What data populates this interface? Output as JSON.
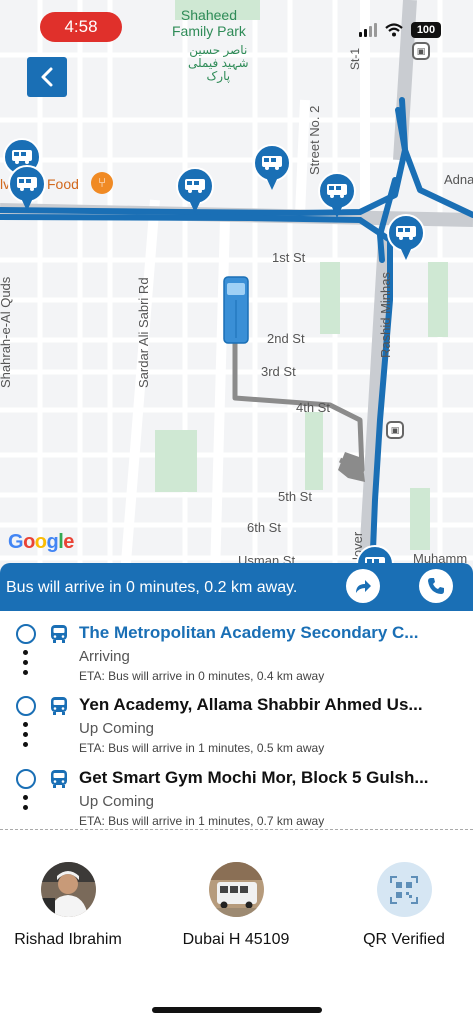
{
  "status_bar": {
    "time": "4:58",
    "battery": "100"
  },
  "map": {
    "park_name": "Shaheed\nFamily Park",
    "park_name_urdu": "ناصر حسین\nشہید فیملی\nپارک",
    "food_label": "Food",
    "food_label_prefix": "lv",
    "streets": {
      "st1": "St-1",
      "street_no2": "Street No. 2",
      "adna": "Adna",
      "first_st": "1st St",
      "second_st": "2nd St",
      "third_st": "3rd St",
      "fourth_st": "4th St",
      "fifth_st": "5th St",
      "sixth_st": "6th St",
      "usman_st": "Usman St",
      "muhamm": "Muhamm",
      "sardar_ali_sabri_rd": "Sardar Ali Sabri Rd",
      "shahrah_e_al_quds": "Shahrah-e-Al Quds",
      "rashid_minhas": "Rashid Minhas",
      "flyover": "lover"
    },
    "google_logo": "Google",
    "pin_icon": "bus-icon",
    "colors": {
      "route": "#1a6fb5",
      "trail": "#888888",
      "park": "#cfe8d3"
    }
  },
  "banner": {
    "text": "Bus will arrive in 0 minutes, 0.2 km away.",
    "directions_icon": "directions-icon",
    "call_icon": "phone-icon"
  },
  "stops": [
    {
      "name": "The Metropolitan Academy Secondary C...",
      "status": "Arriving",
      "eta": "ETA: Bus will arrive in 0 minutes, 0.4 km away"
    },
    {
      "name": "Yen Academy, Allama Shabbir Ahmed Us...",
      "status": "Up Coming",
      "eta": "ETA: Bus will arrive in 1 minutes, 0.5 km away"
    },
    {
      "name": "Get Smart Gym Mochi Mor, Block 5 Gulsh...",
      "status": "Up Coming",
      "eta": "ETA: Bus will arrive in 1 minutes, 0.7 km away"
    }
  ],
  "footer": {
    "driver": "Rishad Ibrahim",
    "vehicle": "Dubai H 45109",
    "qr": "QR Verified"
  },
  "theme": {
    "accent": "#1a6fb5",
    "alert": "#e0302b"
  }
}
